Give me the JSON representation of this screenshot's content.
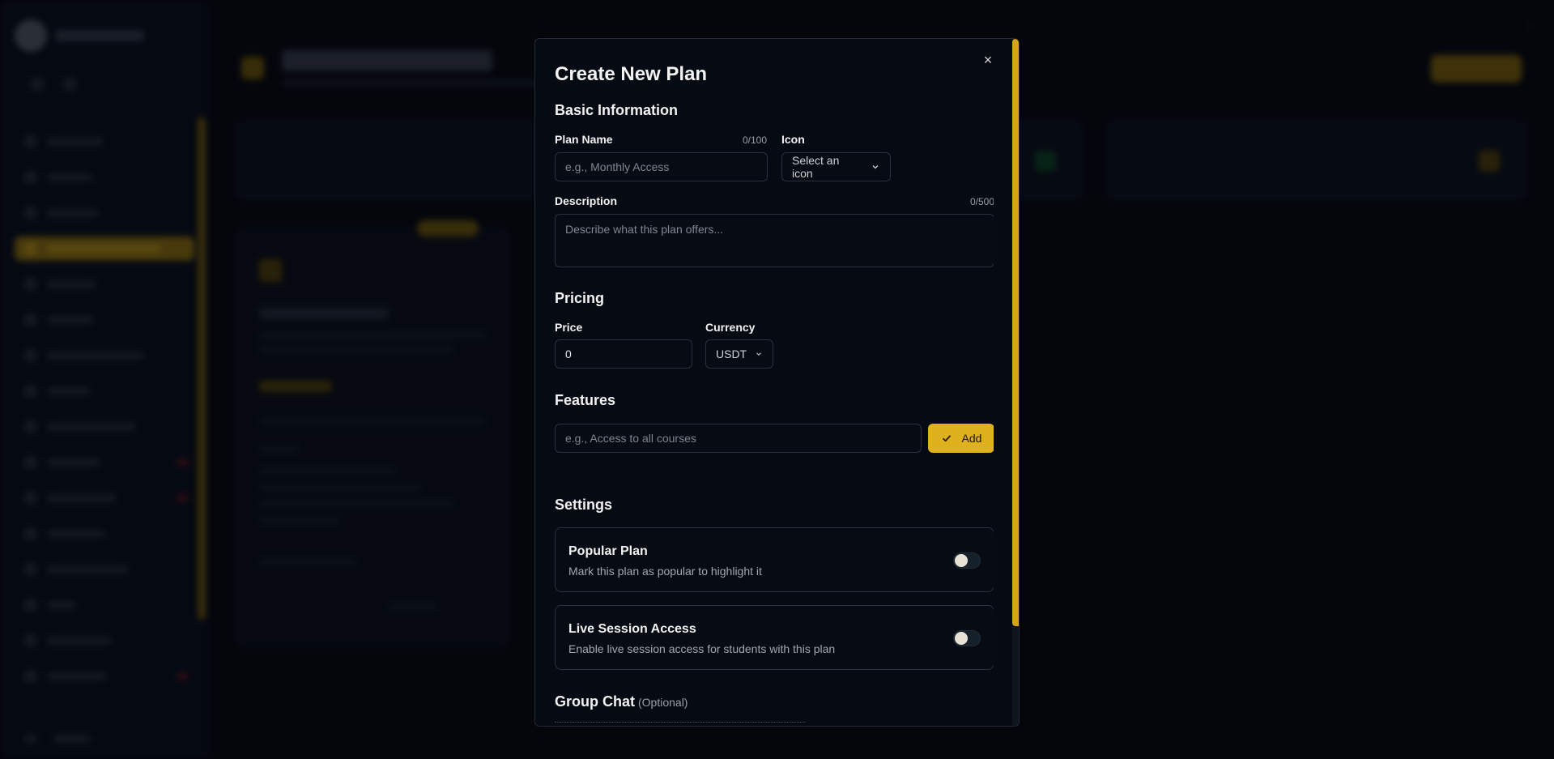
{
  "modal": {
    "title": "Create New Plan",
    "close_glyph": "×",
    "basic": {
      "heading": "Basic Information",
      "plan_name_label": "Plan Name",
      "plan_name_counter": "0/100",
      "plan_name_placeholder": "e.g., Monthly Access",
      "icon_label": "Icon",
      "icon_select": "Select an icon",
      "description_label": "Description",
      "description_counter": "0/500",
      "description_placeholder": "Describe what this plan offers..."
    },
    "pricing": {
      "heading": "Pricing",
      "price_label": "Price",
      "price_value": "0",
      "currency_label": "Currency",
      "currency_value": "USDT"
    },
    "features": {
      "heading": "Features",
      "placeholder": "e.g., Access to all courses",
      "add_label": "Add"
    },
    "settings": {
      "heading": "Settings",
      "items": [
        {
          "title": "Popular Plan",
          "description": "Mark this plan as popular to highlight it",
          "enabled": false
        },
        {
          "title": "Live Session Access",
          "description": "Enable live session access for students with this plan",
          "enabled": false
        }
      ]
    },
    "group_chat": {
      "heading": "Group Chat",
      "optional": "(Optional)"
    }
  },
  "colors": {
    "accent": "#e0b11f",
    "modal_bg": "#060a12",
    "border": "#263140"
  }
}
